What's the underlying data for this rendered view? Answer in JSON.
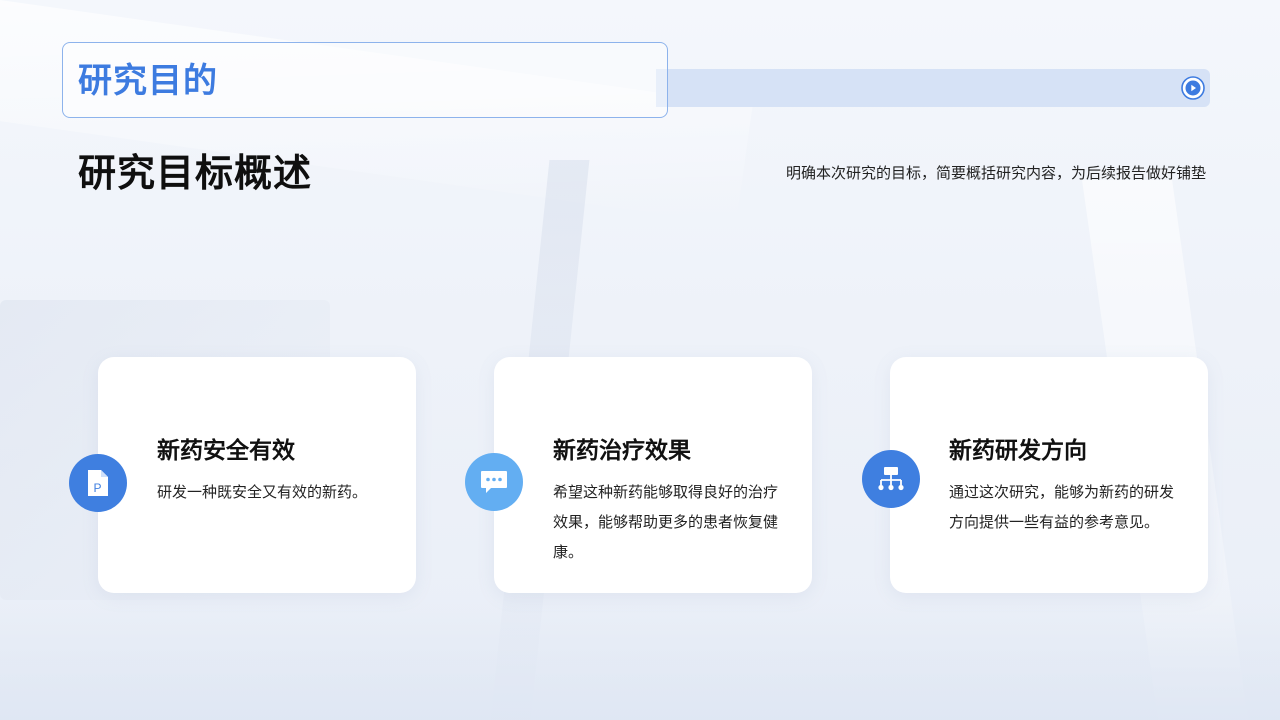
{
  "header": {
    "section_title": "研究目的",
    "play_icon": "play-circle-icon"
  },
  "intro": {
    "heading": "研究目标概述",
    "summary": "明确本次研究的目标，简要概括研究内容，为后续报告做好铺垫"
  },
  "cards": [
    {
      "icon": "document-p-icon",
      "title": "新药安全有效",
      "description": "研发一种既安全又有效的新药。"
    },
    {
      "icon": "chat-bubble-icon",
      "title": "新药治疗效果",
      "description": "希望这种新药能够取得良好的治疗效果，能够帮助更多的患者恢复健康。"
    },
    {
      "icon": "hierarchy-icon",
      "title": "新药研发方向",
      "description": "通过这次研究，能够为新药的研发方向提供一些有益的参考意见。"
    }
  ],
  "colors": {
    "accent_blue": "#3d7be0",
    "light_blue": "#63aef2",
    "bar_blue": "#d6e2f6"
  }
}
